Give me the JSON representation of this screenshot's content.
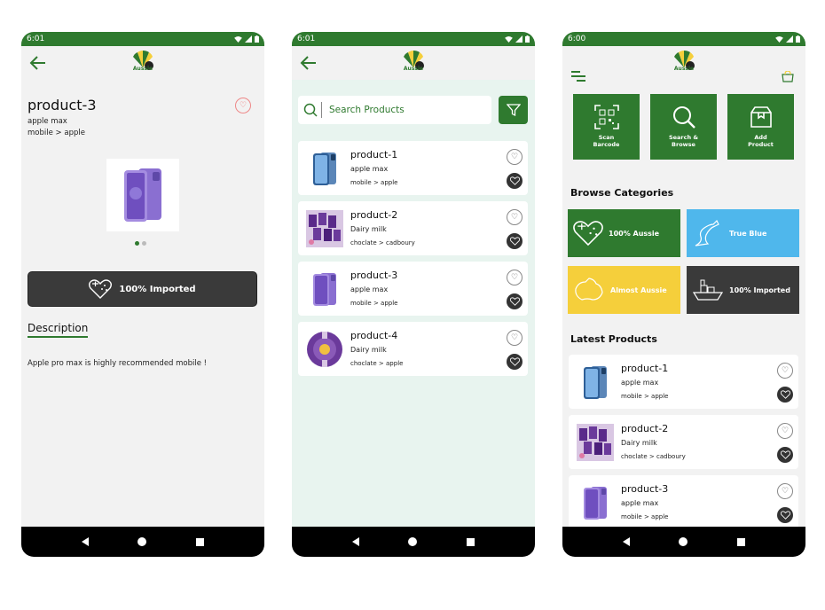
{
  "phone1": {
    "status_time": "6:01",
    "logo_text": "Aussie",
    "product_name": "product-3",
    "brand": "apple max",
    "category_path": "mobile > apple",
    "imported_label": "100% Imported",
    "description_title": "Description",
    "description_text": "Apple pro max is highly recommended mobile !"
  },
  "phone2": {
    "status_time": "6:01",
    "logo_text": "Aussie",
    "search_placeholder": "Search Products",
    "products": [
      {
        "name": "product-1",
        "brand": "apple max",
        "category": "mobile > apple",
        "image": "iphone-blue"
      },
      {
        "name": "product-2",
        "brand": "Dairy milk",
        "category": "choclate > cadboury",
        "image": "chocolate-bouquet"
      },
      {
        "name": "product-3",
        "brand": "apple max",
        "category": "mobile > apple",
        "image": "iphone-purple"
      },
      {
        "name": "product-4",
        "brand": "Dairy milk",
        "category": "choclate > apple",
        "image": "chocolate-bouquet"
      }
    ]
  },
  "phone3": {
    "status_time": "6:00",
    "logo_text": "Aussie",
    "actions": [
      {
        "label": "Scan\nBarcode",
        "icon": "qr-code-icon"
      },
      {
        "label": "Search &\nBrowse",
        "icon": "search-icon"
      },
      {
        "label": "Add\nProduct",
        "icon": "box-icon"
      }
    ],
    "browse_categories_title": "Browse Categories",
    "categories": [
      {
        "label": "100% Aussie",
        "color": "#2f7a2f",
        "icon": "aussie-heart-icon"
      },
      {
        "label": "True Blue",
        "color": "#4fb7ec",
        "icon": "kangaroo-icon"
      },
      {
        "label": "Almost Aussie",
        "color": "#f5cf3b",
        "icon": "australia-map-icon"
      },
      {
        "label": "100% Imported",
        "color": "#3a3a3a",
        "icon": "cargo-ship-icon"
      }
    ],
    "latest_products_title": "Latest Products",
    "products": [
      {
        "name": "product-1",
        "brand": "apple max",
        "category": "mobile > apple",
        "image": "iphone-blue"
      },
      {
        "name": "product-2",
        "brand": "Dairy milk",
        "category": "choclate > cadboury",
        "image": "chocolate-bouquet"
      },
      {
        "name": "product-3",
        "brand": "apple max",
        "category": "mobile > apple",
        "image": "iphone-purple"
      }
    ]
  },
  "colors": {
    "brand_green": "#2f7a2f",
    "list_background": "#e8f4ef",
    "dark": "#3a3a3a"
  }
}
